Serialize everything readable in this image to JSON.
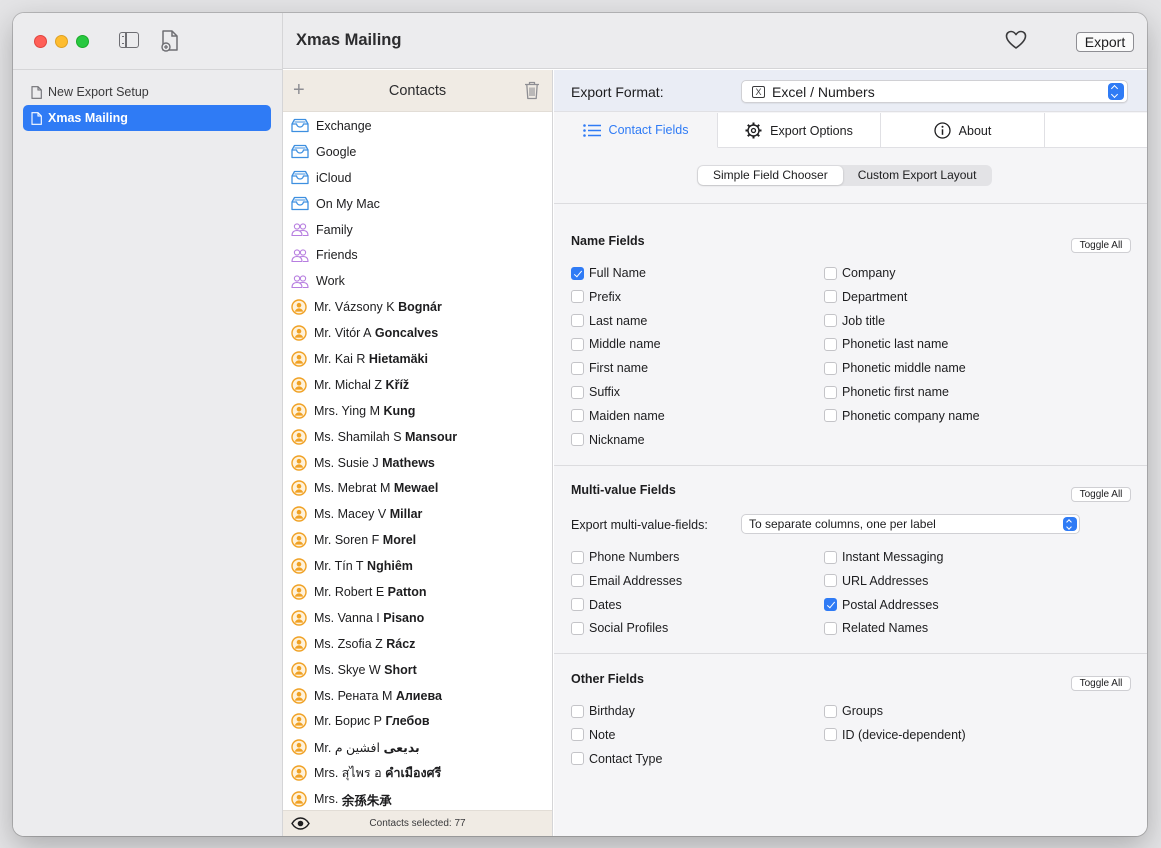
{
  "window": {
    "title": "Xmas Mailing",
    "export_label": "Export"
  },
  "sidebar": {
    "items": [
      {
        "label": "New Export Setup",
        "active": false
      },
      {
        "label": "Xmas Mailing",
        "active": true
      }
    ]
  },
  "contacts": {
    "title": "Contacts",
    "accounts": [
      {
        "label": "Exchange",
        "icon": "inbox-tray-icon"
      },
      {
        "label": "Google",
        "icon": "inbox-tray-icon"
      },
      {
        "label": "iCloud",
        "icon": "inbox-tray-icon"
      },
      {
        "label": "On My Mac",
        "icon": "inbox-tray-icon"
      }
    ],
    "groups": [
      {
        "label": "Family",
        "icon": "group-icon"
      },
      {
        "label": "Friends",
        "icon": "group-icon"
      },
      {
        "label": "Work",
        "icon": "group-icon"
      }
    ],
    "people": [
      {
        "prefix": "Mr. Vázsony K",
        "surname": "Bognár"
      },
      {
        "prefix": "Mr. Vitór A",
        "surname": "Goncalves"
      },
      {
        "prefix": "Mr. Kai R",
        "surname": "Hietamäki"
      },
      {
        "prefix": "Mr. Michal Z",
        "surname": "Kříž"
      },
      {
        "prefix": "Mrs. Ying M",
        "surname": "Kung"
      },
      {
        "prefix": "Ms. Shamilah S",
        "surname": "Mansour"
      },
      {
        "prefix": "Ms. Susie J",
        "surname": "Mathews"
      },
      {
        "prefix": "Ms. Mebrat M",
        "surname": "Mewael"
      },
      {
        "prefix": "Ms. Macey V",
        "surname": "Millar"
      },
      {
        "prefix": "Mr. Soren F",
        "surname": "Morel"
      },
      {
        "prefix": "Mr. Tín T",
        "surname": "Nghiêm"
      },
      {
        "prefix": "Mr. Robert E",
        "surname": "Patton"
      },
      {
        "prefix": "Ms. Vanna I",
        "surname": "Pisano"
      },
      {
        "prefix": "Ms. Zsofia Z",
        "surname": "Rácz"
      },
      {
        "prefix": "Ms. Skye W",
        "surname": "Short"
      },
      {
        "prefix": "Ms. Рената М",
        "surname": "Алиева"
      },
      {
        "prefix": "Mr. Борис Р",
        "surname": "Глебов"
      },
      {
        "prefix": "Mr. افشین م",
        "surname": "بدیعی"
      },
      {
        "prefix": "Mrs. สุไพร อ",
        "surname": "คำเมืองศรี"
      },
      {
        "prefix": "Mrs.",
        "surname": "余孫朱承"
      }
    ],
    "footer": "Contacts selected: 77"
  },
  "export": {
    "format_label": "Export Format:",
    "format_value": "Excel / Numbers",
    "tabs": [
      {
        "label": "Contact Fields",
        "icon": "list-icon",
        "active": true
      },
      {
        "label": "Export Options",
        "icon": "gear-icon",
        "active": false
      },
      {
        "label": "About",
        "icon": "info-icon",
        "active": false
      }
    ],
    "modes": [
      "Simple Field Chooser",
      "Custom Export Layout"
    ],
    "toggle_all": "Toggle All",
    "name_fields": {
      "title": "Name Fields",
      "left": [
        {
          "label": "Full Name",
          "checked": true
        },
        {
          "label": "Prefix",
          "checked": false
        },
        {
          "label": "Last name",
          "checked": false
        },
        {
          "label": "Middle name",
          "checked": false
        },
        {
          "label": "First name",
          "checked": false
        },
        {
          "label": "Suffix",
          "checked": false
        },
        {
          "label": "Maiden name",
          "checked": false
        },
        {
          "label": "Nickname",
          "checked": false
        }
      ],
      "right": [
        {
          "label": "Company",
          "checked": false
        },
        {
          "label": "Department",
          "checked": false
        },
        {
          "label": "Job title",
          "checked": false
        },
        {
          "label": "Phonetic last name",
          "checked": false
        },
        {
          "label": "Phonetic middle name",
          "checked": false
        },
        {
          "label": "Phonetic first name",
          "checked": false
        },
        {
          "label": "Phonetic company name",
          "checked": false
        }
      ]
    },
    "multi_value": {
      "title": "Multi-value Fields",
      "mode_label": "Export multi-value-fields:",
      "mode_value": "To separate columns, one per label",
      "left": [
        {
          "label": "Phone Numbers",
          "checked": false
        },
        {
          "label": "Email Addresses",
          "checked": false
        },
        {
          "label": "Dates",
          "checked": false
        },
        {
          "label": "Social Profiles",
          "checked": false
        }
      ],
      "right": [
        {
          "label": "Instant Messaging",
          "checked": false
        },
        {
          "label": "URL Addresses",
          "checked": false
        },
        {
          "label": "Postal Addresses",
          "checked": true
        },
        {
          "label": "Related Names",
          "checked": false
        }
      ]
    },
    "other": {
      "title": "Other Fields",
      "left": [
        {
          "label": "Birthday",
          "checked": false
        },
        {
          "label": "Note",
          "checked": false
        },
        {
          "label": "Contact Type",
          "checked": false
        }
      ],
      "right": [
        {
          "label": "Groups",
          "checked": false
        },
        {
          "label": "ID (device-dependent)",
          "checked": false
        }
      ]
    }
  }
}
